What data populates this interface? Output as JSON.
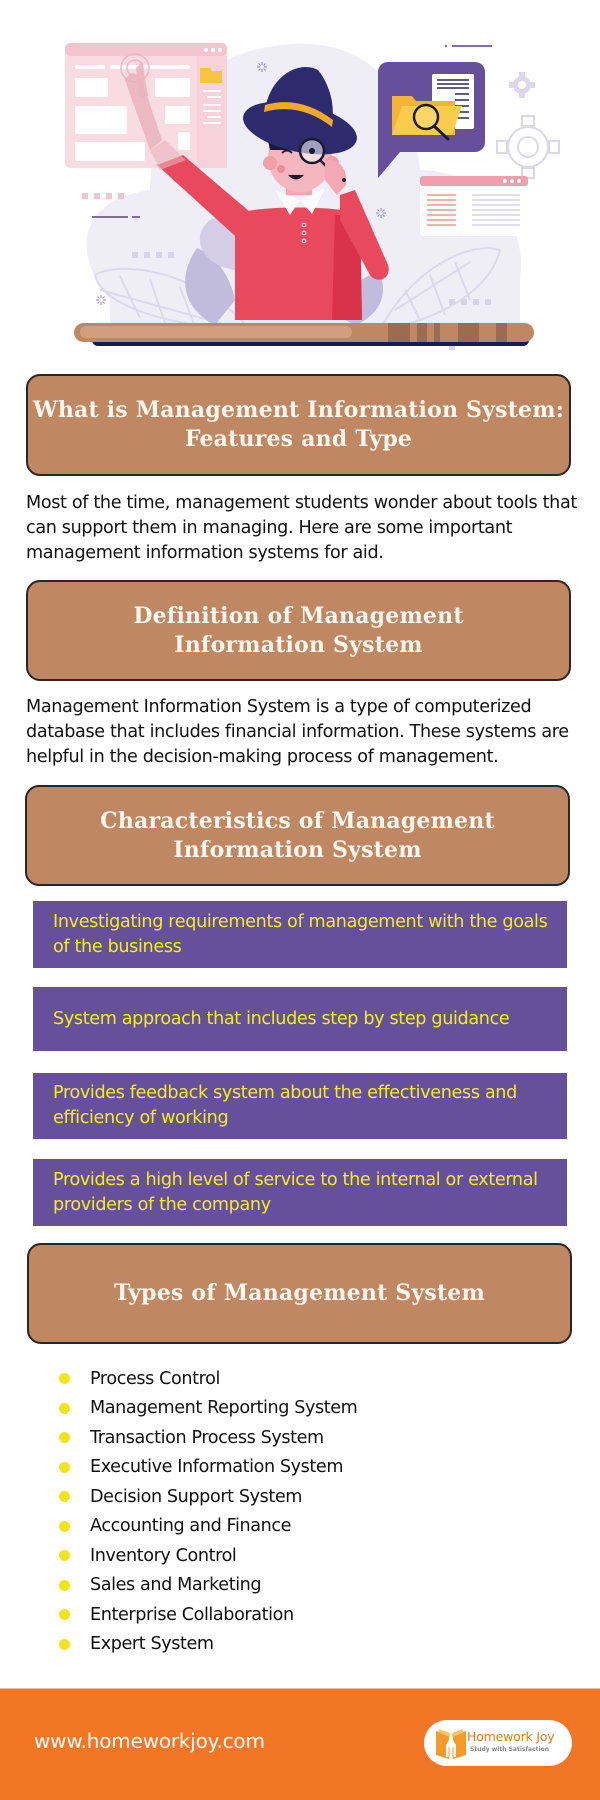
{
  "hero": {
    "illustration": "man-with-hat-and-magnifying-glass-pointing-at-screens",
    "icons": [
      "browser-window-icon",
      "folder-icon",
      "magnifying-glass-icon",
      "speech-bubble-icon",
      "gear-icon",
      "document-icon"
    ]
  },
  "sections": {
    "intro": {
      "title": "What is Management Information System: Features and Type",
      "title_lines": [
        "What is Management Information System:",
        "Features and Type"
      ],
      "body": "Most of the time, management students wonder about tools that can support them in managing. Here are some important management information systems for aid."
    },
    "definition": {
      "title_lines": [
        "Definition of Management",
        "Information System"
      ],
      "body": "Management Information System is a type of computerized database that includes financial information. These systems are helpful in the decision-making process of management."
    },
    "characteristics": {
      "title_lines": [
        "Characteristics of Management",
        "Information System"
      ],
      "items": [
        "Investigating requirements of management with the goals of the business",
        "System approach that includes step by step guidance",
        "Provides feedback system about the effectiveness and efficiency of working",
        "Provides a high level of service to the internal or external providers of the company"
      ]
    },
    "types": {
      "title": "Types of Management System",
      "items": [
        "Process Control",
        "Management Reporting System",
        "Transaction Process System",
        "Executive Information System",
        "Decision Support System",
        "Accounting and Finance",
        "Inventory Control",
        "Sales and Marketing",
        "Enterprise Collaboration",
        "Expert System"
      ]
    }
  },
  "footer": {
    "url": "www.homeworkjoy.com",
    "logo": {
      "name": "Homework Joy",
      "tagline": "Study with Satisfaction",
      "icon": "open-book-icon"
    }
  },
  "colors": {
    "title_box": "#c08763",
    "title_border": "#2a2624",
    "characteristic_box": "#66509c",
    "characteristic_text": "#f4ee1e",
    "bullet": "#f1e41a",
    "footer": "#f37627"
  }
}
